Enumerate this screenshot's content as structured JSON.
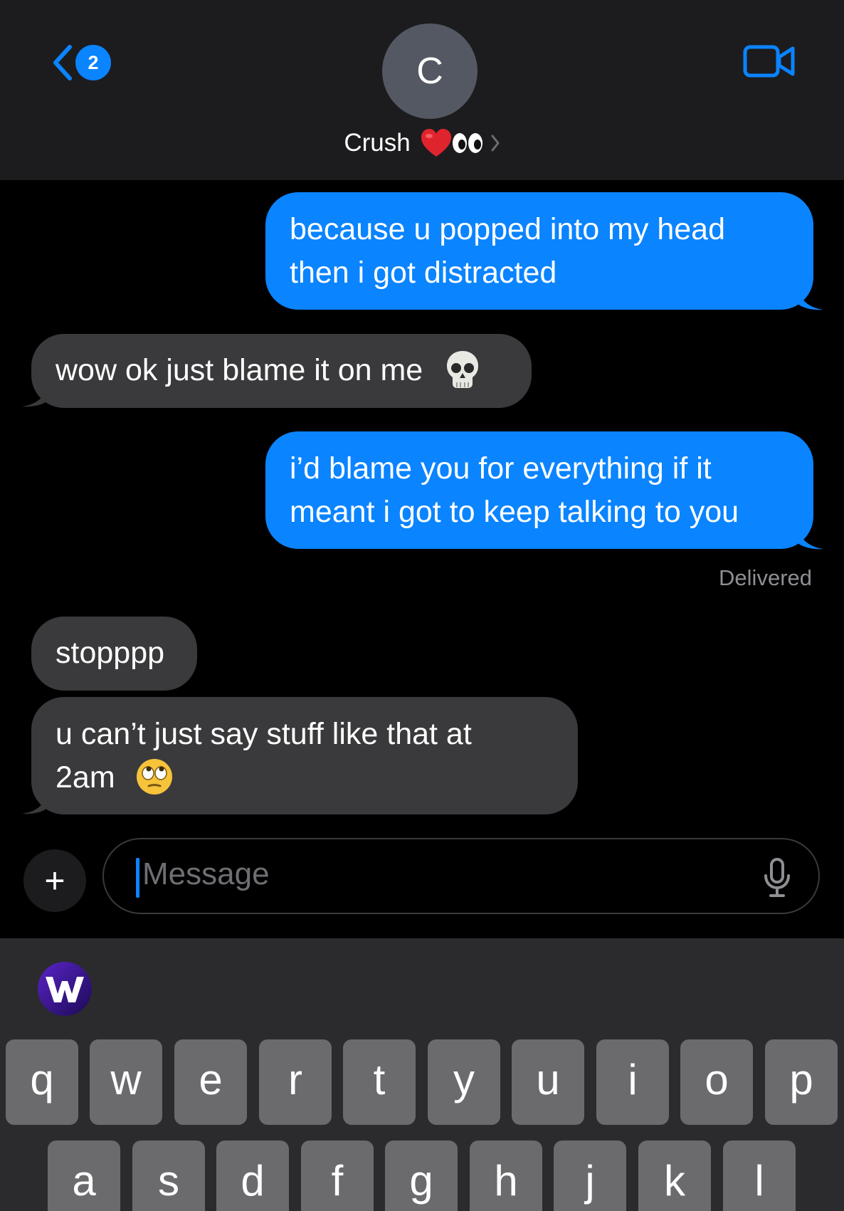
{
  "header": {
    "back_count": "2",
    "avatar_initial": "C",
    "contact_name": "Crush",
    "contact_emoji": [
      "heart-emoji",
      "eyes-emoji"
    ],
    "accent": "#0a84ff"
  },
  "messages": [
    {
      "dir": "sent",
      "lines": [
        "because u popped into my head",
        "then i got distracted"
      ]
    },
    {
      "dir": "received",
      "lines": [
        "wow ok just blame it on me"
      ],
      "emoji": "skull-emoji"
    },
    {
      "dir": "sent",
      "lines": [
        "i’d blame you for everything if it",
        "meant i got to keep talking to you"
      ]
    },
    {
      "dir": "received",
      "lines": [
        "stopppp"
      ]
    },
    {
      "dir": "received",
      "lines": [
        "u can’t just say stuff like that at",
        "2am"
      ],
      "emoji": "face-with-rolling-eyes-emoji"
    }
  ],
  "delivered_label": "Delivered",
  "composer": {
    "plus_label": "+",
    "placeholder": "Message"
  },
  "keyboard": {
    "row1": [
      "q",
      "w",
      "e",
      "r",
      "t",
      "y",
      "u",
      "i",
      "o",
      "p"
    ],
    "row2": [
      "a",
      "s",
      "d",
      "f",
      "g",
      "h",
      "j",
      "k",
      "l"
    ]
  },
  "colors": {
    "sent_bubble": "#0a84ff",
    "received_bubble": "#3a3a3c",
    "header_bg": "#1c1c1e",
    "keyboard_bg": "#2b2b2d",
    "key_bg": "#6b6b6e"
  }
}
